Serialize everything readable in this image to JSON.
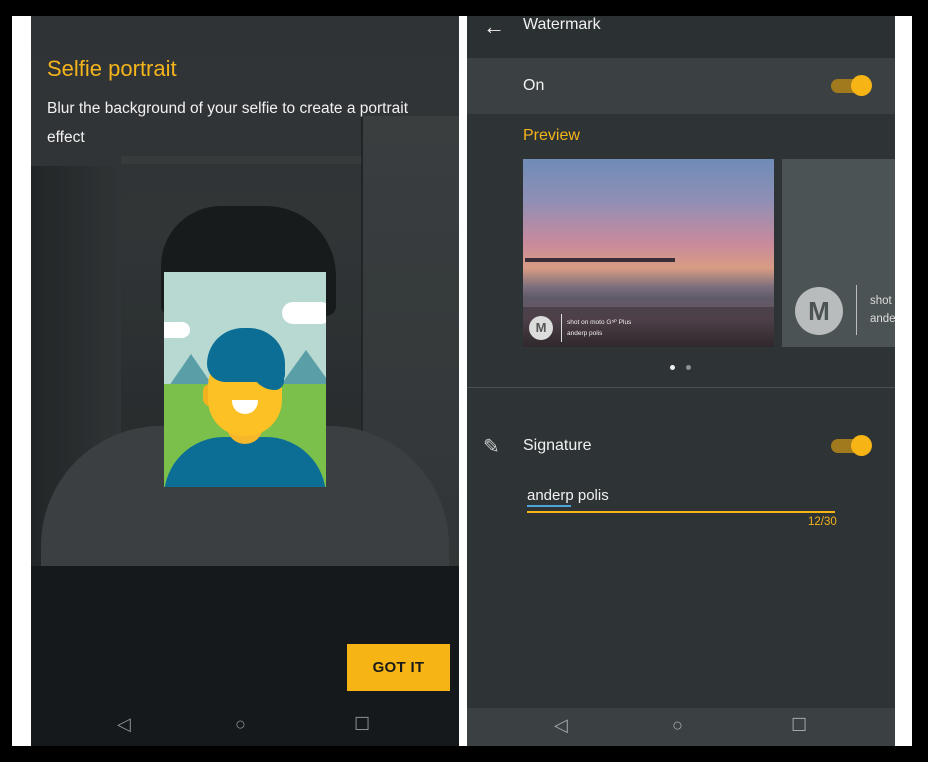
{
  "left_screen": {
    "title": "Selfie portrait",
    "description": "Blur the background of your selfie to create a portrait effect",
    "got_it_label": "GOT IT",
    "nav": {
      "back": "◁",
      "home": "○",
      "recents": "☐"
    }
  },
  "right_screen": {
    "header": {
      "back_icon": "←",
      "title": "Watermark"
    },
    "on_row": {
      "label": "On",
      "toggle_on": true
    },
    "preview": {
      "label": "Preview",
      "card1": {
        "logo": "M",
        "line1": "shot on moto G⁵ᴾ Plus",
        "line2": "anderp polis"
      },
      "card2": {
        "logo": "M",
        "line1": "shot",
        "line2": "ande"
      },
      "page_dots": {
        "count": 2,
        "active_index": 0
      }
    },
    "signature": {
      "icon": "✎",
      "label": "Signature",
      "toggle_on": true,
      "value": "anderp polis",
      "counter": "12/30"
    },
    "nav": {
      "back": "◁",
      "home": "○",
      "recents": "☐"
    }
  },
  "colors": {
    "accent": "#f6b415",
    "toggle_track": "#a17a1e",
    "dark_bg": "#2e3335",
    "row_bg": "#3b4143"
  }
}
